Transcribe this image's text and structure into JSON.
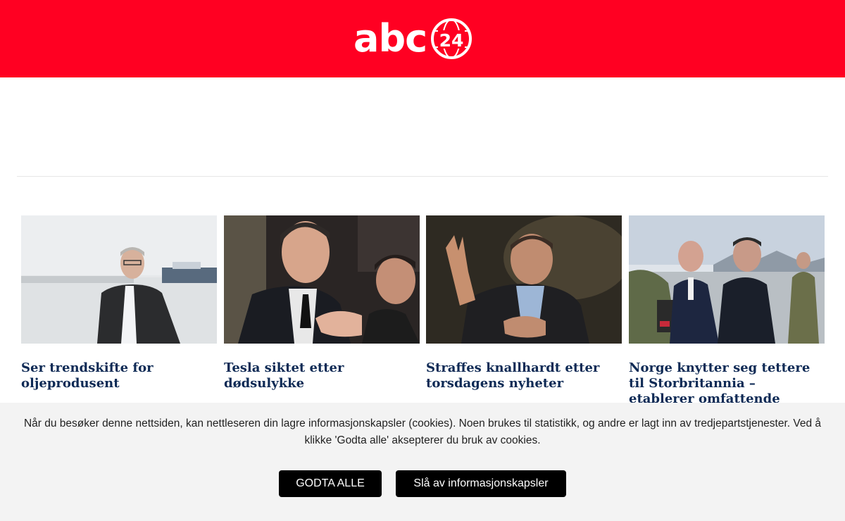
{
  "header": {
    "logo_text": "abc",
    "logo_number": "24",
    "background": "#ff0022"
  },
  "articles": [
    {
      "headline": "Ser trendskifte for oljeprodusent"
    },
    {
      "headline": "Tesla siktet etter dødsulykke"
    },
    {
      "headline": "Straffes knallhardt etter torsdagens nyheter"
    },
    {
      "headline": "Norge knytter seg tettere til Storbritannia – etablerer omfattende forsvarsavtale"
    }
  ],
  "cookie_banner": {
    "message": "Når du besøker denne nettsiden, kan nettleseren din lagre informasjonskapsler (cookies). Noen brukes til statistikk, og andre er lagt inn av tredjepartstjenester. Ved å klikke 'Godta alle' aksepterer du bruk av cookies.",
    "accept_label": "GODTA ALLE",
    "reject_label": "Slå av informasjonskapsler"
  },
  "colors": {
    "brand_red": "#ff0022",
    "headline": "#0e2a55",
    "button": "#000000"
  }
}
